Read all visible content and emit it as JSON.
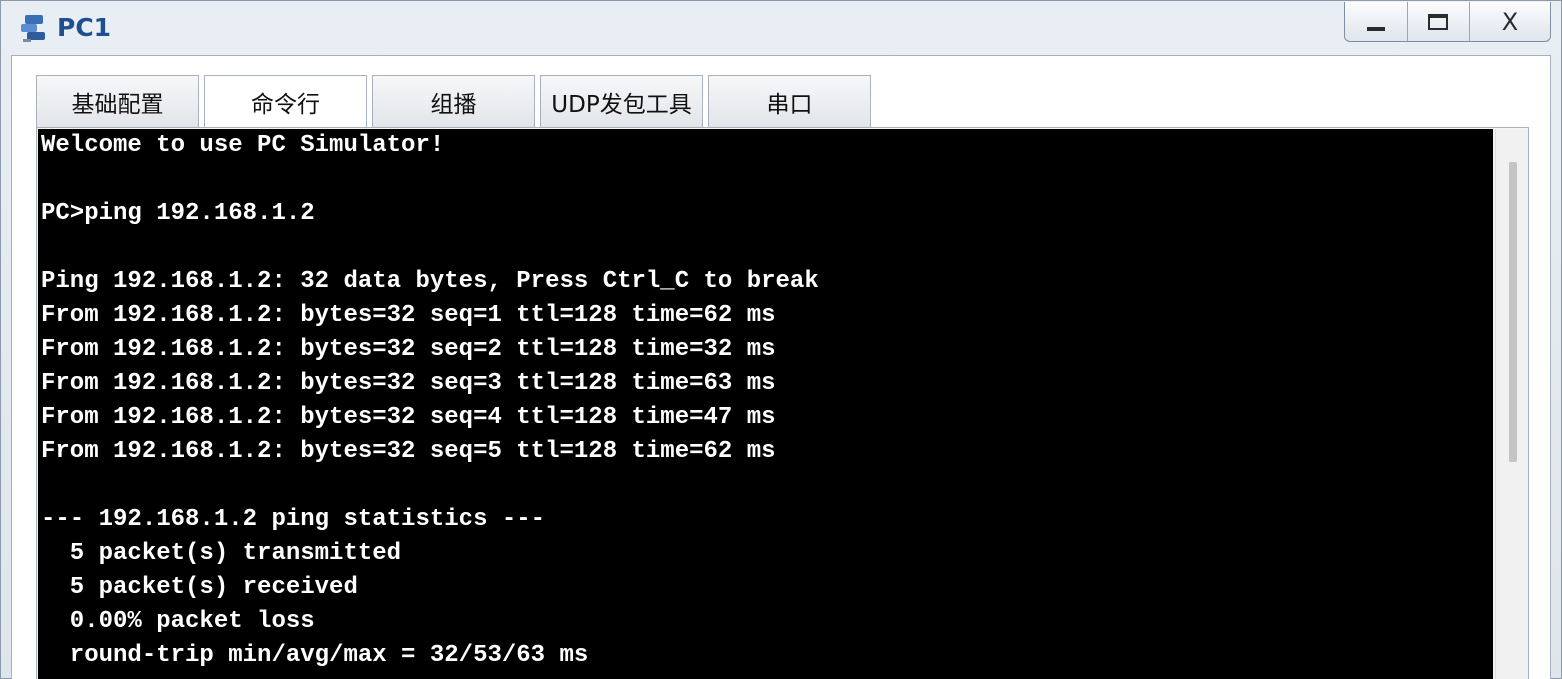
{
  "window": {
    "title": "PC1",
    "controls": {
      "minimize": "minimize",
      "maximize": "maximize",
      "close": "X"
    }
  },
  "tabs": [
    {
      "label": "基础配置",
      "active": false
    },
    {
      "label": "命令行",
      "active": true
    },
    {
      "label": "组播",
      "active": false
    },
    {
      "label": "UDP发包工具",
      "active": false
    },
    {
      "label": "串口",
      "active": false
    }
  ],
  "console": {
    "lines": [
      "Welcome to use PC Simulator!",
      "",
      "PC>ping 192.168.1.2",
      "",
      "Ping 192.168.1.2: 32 data bytes, Press Ctrl_C to break",
      "From 192.168.1.2: bytes=32 seq=1 ttl=128 time=62 ms",
      "From 192.168.1.2: bytes=32 seq=2 ttl=128 time=32 ms",
      "From 192.168.1.2: bytes=32 seq=3 ttl=128 time=63 ms",
      "From 192.168.1.2: bytes=32 seq=4 ttl=128 time=47 ms",
      "From 192.168.1.2: bytes=32 seq=5 ttl=128 time=62 ms",
      "",
      "--- 192.168.1.2 ping statistics ---",
      "  5 packet(s) transmitted",
      "  5 packet(s) received",
      "  0.00% packet loss",
      "  round-trip min/avg/max = 32/53/63 ms"
    ]
  },
  "colors": {
    "title": "#1f4f8f",
    "console_bg": "#000000",
    "console_fg": "#ffffff"
  },
  "icons": {
    "app": "pc-simulator-icon"
  }
}
